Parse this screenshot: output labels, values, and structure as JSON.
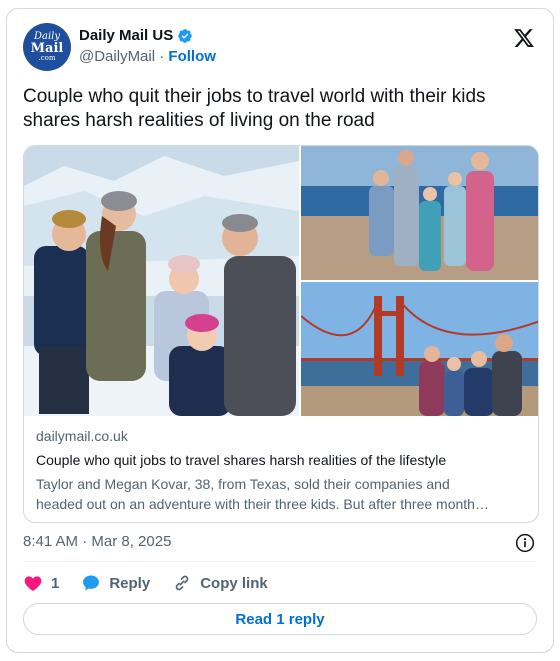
{
  "account": {
    "avatar_line1": "Daily",
    "avatar_line2": "Mail",
    "avatar_line3": ".com",
    "display_name": "Daily Mail US",
    "handle": "@DailyMail",
    "separator": "·",
    "follow_label": "Follow",
    "verified_icon": "verified-badge-icon",
    "brand_color": "#1f4e9c"
  },
  "tweet": {
    "text": "Couple who quit their jobs to travel world with their kids shares harsh realities of living on the road",
    "timestamp": "8:41 AM · Mar 8, 2025"
  },
  "link_card": {
    "domain": "dailymail.co.uk",
    "title": "Couple who quit jobs to travel shares harsh realities of the lifestyle",
    "description_line1": "Taylor and Megan Kovar, 38, from Texas, sold their companies and",
    "description_line2": "headed out on an adventure with their three kids. But after three month…",
    "images": [
      "family-glacier-photo",
      "family-coast-photo",
      "family-golden-gate-photo"
    ]
  },
  "actions": {
    "like_count": "1",
    "reply_label": "Reply",
    "copy_link_label": "Copy link",
    "read_replies_label": "Read 1 reply",
    "like_color": "#f91880",
    "accent_color": "#006fd6"
  }
}
